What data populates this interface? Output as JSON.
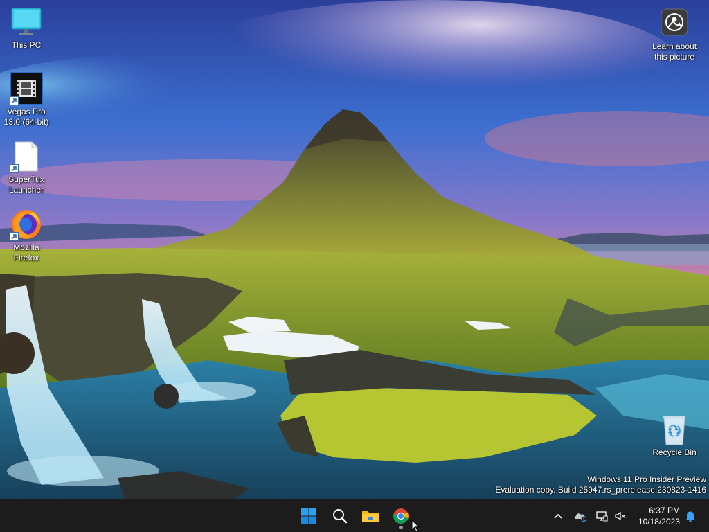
{
  "desktop": {
    "icons": [
      {
        "label": "This PC",
        "icon": "monitor-icon"
      },
      {
        "label": "Vegas Pro\n13.0 (64-bit)",
        "icon": "film-icon"
      },
      {
        "label": "SuperTux\nLauncher",
        "icon": "blank-file-icon"
      },
      {
        "label": "Mozilla\nFirefox",
        "icon": "firefox-icon"
      },
      {
        "label": "Learn about\nthis picture",
        "icon": "camera-icon"
      },
      {
        "label": "Recycle Bin",
        "icon": "recycle-bin-icon"
      }
    ],
    "watermark": {
      "line1": "Windows 11 Pro Insider Preview",
      "line2": "Evaluation copy. Build 25947.rs_prerelease.230823-1416"
    }
  },
  "taskbar": {
    "apps": [
      {
        "name": "Start",
        "icon": "windows-start-icon"
      },
      {
        "name": "Search",
        "icon": "search-icon"
      },
      {
        "name": "File Explorer",
        "icon": "folder-icon"
      },
      {
        "name": "Google Chrome",
        "icon": "chrome-icon",
        "running": true
      }
    ],
    "tray": {
      "icons": [
        "chevron-up-icon",
        "onedrive-icon",
        "network-icon",
        "volume-muted-icon",
        "notification-bell-icon"
      ]
    },
    "clock": {
      "time": "6:37 PM",
      "date": "10/18/2023"
    }
  },
  "colors": {
    "taskbar_bg": "#1c1c1c",
    "accent_blue": "#0078d4"
  }
}
